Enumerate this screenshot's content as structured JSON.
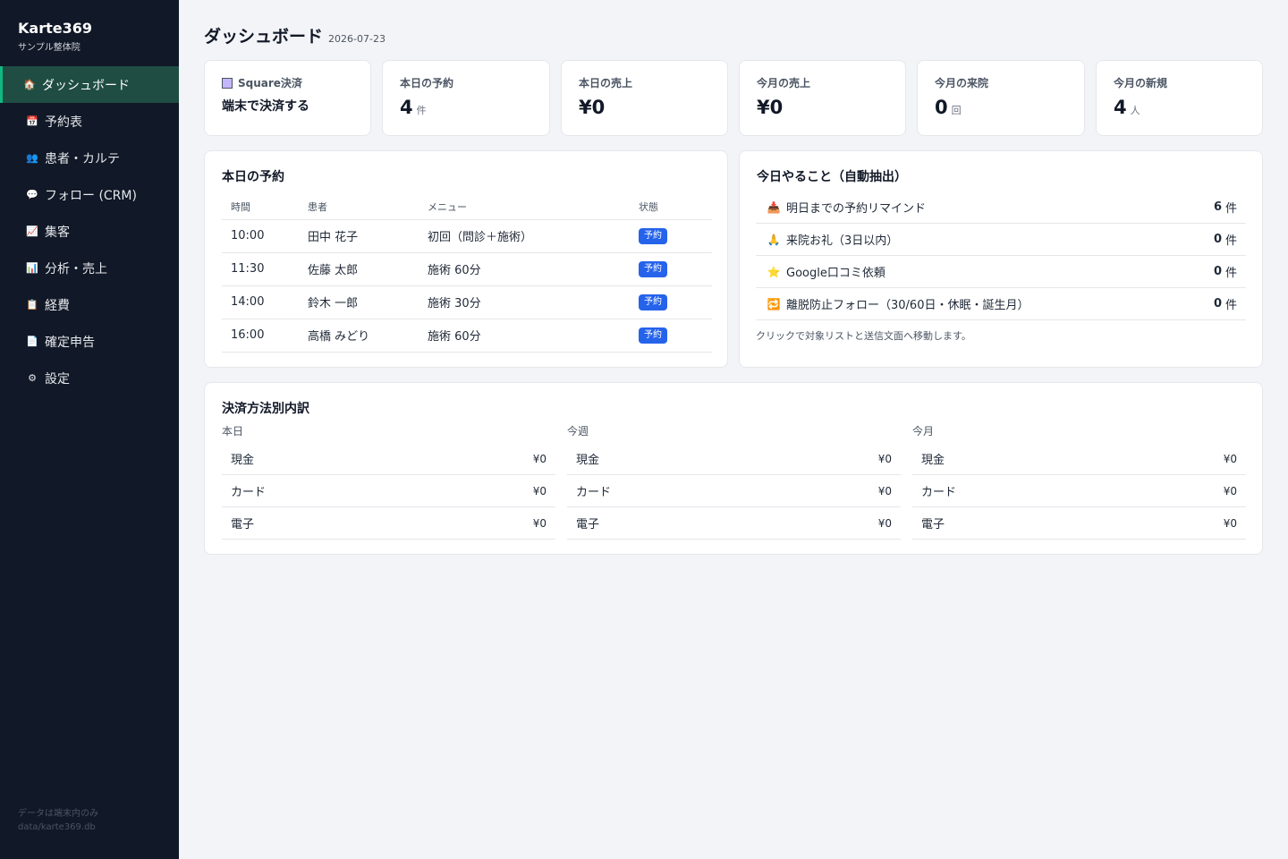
{
  "app": {
    "name": "Karte369",
    "clinic": "サンプル整体院"
  },
  "sidebar": {
    "items": [
      {
        "label": "ダッシュボード",
        "icon": "house-icon",
        "glyph": "🏠",
        "active": true
      },
      {
        "label": "予約表",
        "icon": "calendar-icon",
        "glyph": "📅",
        "active": false
      },
      {
        "label": "患者・カルテ",
        "icon": "people-icon",
        "glyph": "👥",
        "active": false
      },
      {
        "label": "フォロー (CRM)",
        "icon": "speech-bubble-icon",
        "glyph": "💬",
        "active": false
      },
      {
        "label": "集客",
        "icon": "chart-up-icon",
        "glyph": "📈",
        "active": false
      },
      {
        "label": "分析・売上",
        "icon": "bar-chart-icon",
        "glyph": "📊",
        "active": false
      },
      {
        "label": "経費",
        "icon": "receipt-icon",
        "glyph": "📋",
        "active": false
      },
      {
        "label": "確定申告",
        "icon": "document-icon",
        "glyph": "📄",
        "active": false
      },
      {
        "label": "設定",
        "icon": "gear-icon",
        "glyph": "⚙",
        "active": false
      }
    ],
    "footer_line1": "データは端末内のみ",
    "footer_line2": "data/karte369.db"
  },
  "header": {
    "title": "ダッシュボード",
    "date": "2026-07-23"
  },
  "stats": {
    "square": {
      "label": "Square決済",
      "action": "端末で決済する"
    },
    "cards": [
      {
        "label": "本日の予約",
        "value": "4",
        "unit": "件"
      },
      {
        "label": "本日の売上",
        "value": "¥0",
        "unit": ""
      },
      {
        "label": "今月の売上",
        "value": "¥0",
        "unit": ""
      },
      {
        "label": "今月の来院",
        "value": "0",
        "unit": "回"
      },
      {
        "label": "今月の新規",
        "value": "4",
        "unit": "人"
      }
    ]
  },
  "reservations": {
    "title": "本日の予約",
    "columns": [
      "時間",
      "患者",
      "メニュー",
      "状態"
    ],
    "rows": [
      {
        "time": "10:00",
        "patient": "田中 花子",
        "menu": "初回（問診＋施術）",
        "status": "予約"
      },
      {
        "time": "11:30",
        "patient": "佐藤 太郎",
        "menu": "施術 60分",
        "status": "予約"
      },
      {
        "time": "14:00",
        "patient": "鈴木 一郎",
        "menu": "施術 30分",
        "status": "予約"
      },
      {
        "time": "16:00",
        "patient": "高橋 みどり",
        "menu": "施術 60分",
        "status": "予約"
      }
    ],
    "status_color": "#2563eb"
  },
  "todo": {
    "title": "今日やること（自動抽出）",
    "items": [
      {
        "label": "明日までの予約リマインド",
        "count": "6",
        "unit": "件",
        "icon": "inbox-tray-icon",
        "glyph": "📥"
      },
      {
        "label": "来院お礼（3日以内）",
        "count": "0",
        "unit": "件",
        "icon": "folded-hands-icon",
        "glyph": "🙏"
      },
      {
        "label": "Google口コミ依頼",
        "count": "0",
        "unit": "件",
        "icon": "star-icon",
        "glyph": "⭐"
      },
      {
        "label": "離脱防止フォロー（30/60日・休眠・誕生月）",
        "count": "0",
        "unit": "件",
        "icon": "repeat-icon",
        "glyph": "🔁"
      }
    ],
    "note": "クリックで対象リストと送信文面へ移動します。"
  },
  "payments": {
    "title": "決済方法別内訳",
    "periods": [
      {
        "label": "本日",
        "rows": [
          {
            "method": "現金",
            "amount": "¥0"
          },
          {
            "method": "カード",
            "amount": "¥0"
          },
          {
            "method": "電子",
            "amount": "¥0"
          }
        ]
      },
      {
        "label": "今週",
        "rows": [
          {
            "method": "現金",
            "amount": "¥0"
          },
          {
            "method": "カード",
            "amount": "¥0"
          },
          {
            "method": "電子",
            "amount": "¥0"
          }
        ]
      },
      {
        "label": "今月",
        "rows": [
          {
            "method": "現金",
            "amount": "¥0"
          },
          {
            "method": "カード",
            "amount": "¥0"
          },
          {
            "method": "電子",
            "amount": "¥0"
          }
        ]
      }
    ]
  },
  "colors": {
    "sidebar_bg": "#111827",
    "active_bg": "#1f4d43",
    "active_accent": "#10b981",
    "page_bg": "#f3f4f7",
    "badge": "#2563eb"
  }
}
